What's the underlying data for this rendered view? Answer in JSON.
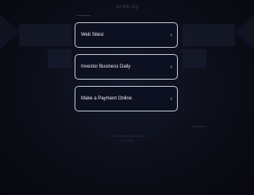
{
  "header": {
    "domain": "scripti.org"
  },
  "links": [
    {
      "label": "Web Sitesi"
    },
    {
      "label": "Investor Business Daily"
    },
    {
      "label": "Make a Payment Online"
    }
  ],
  "icons": {
    "chevron": "›"
  },
  "side_text": "disclaimer",
  "footer": {
    "line1": "© 2024 scripti.org All rights",
    "line2": "reserved"
  },
  "colors": {
    "background": "#0a0c14",
    "card_border": "#c8ccd8",
    "card_text": "#eef0f6"
  }
}
